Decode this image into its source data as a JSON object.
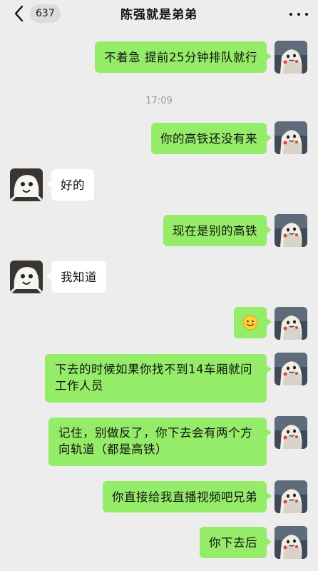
{
  "header": {
    "unread_count": "637",
    "title": "陈强就是弟弟"
  },
  "colors": {
    "background": "#ededed",
    "my_bubble": "#95ec69",
    "their_bubble": "#ffffff"
  },
  "messages": [
    {
      "sender": "me",
      "text": "不着急 提前25分钟排队就行"
    },
    {
      "type": "time",
      "text": "17:09"
    },
    {
      "sender": "me",
      "text": "你的高铁还没有来"
    },
    {
      "sender": "other",
      "text": "好的"
    },
    {
      "sender": "me",
      "text": "现在是别的高铁"
    },
    {
      "sender": "other",
      "text": "我知道"
    },
    {
      "sender": "me",
      "emoji": "smiling-face-emoji"
    },
    {
      "sender": "me",
      "text": "下去的时候如果你找不到14车厢就问工作人员"
    },
    {
      "sender": "me",
      "text": "记住，别做反了，你下去会有两个方向轨道（都是高铁）"
    },
    {
      "sender": "me",
      "text": "你直接给我直播视频吧兄弟"
    },
    {
      "sender": "me",
      "text": "你下去后"
    }
  ]
}
